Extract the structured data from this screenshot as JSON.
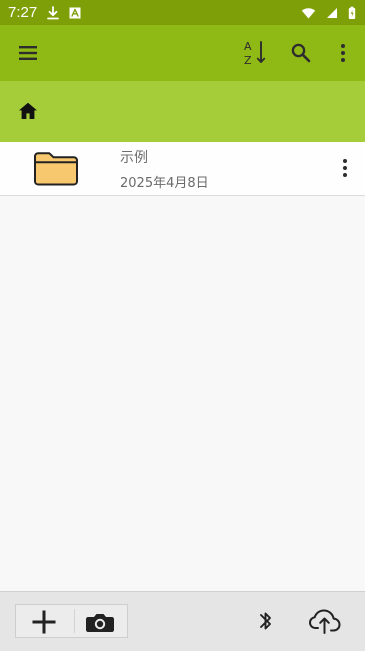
{
  "status_bar": {
    "time": "7:27",
    "left_icons": [
      "download-icon",
      "app-notification-icon"
    ],
    "right_icons": [
      "wifi-icon",
      "signal-icon",
      "battery-icon"
    ]
  },
  "toolbar": {
    "menu_icon": "hamburger-menu-icon",
    "sort_icon": "sort-az-icon",
    "search_icon": "search-icon",
    "more_icon": "more-vert-icon",
    "background": "#8fb915"
  },
  "path_bar": {
    "home_icon": "home-icon",
    "background": "#a5cd39"
  },
  "files": [
    {
      "name": "示例",
      "date": "2025年4月8日",
      "icon": "folder-icon",
      "menu_icon": "more-vert-icon"
    }
  ],
  "bottom_bar": {
    "left_icons": [
      "add-icon",
      "camera-icon"
    ],
    "right_icons": [
      "bluetooth-icon",
      "cloud-upload-icon"
    ],
    "background": "#e5e5e5"
  },
  "theme": {
    "status_bar_color": "#7f9f08",
    "folder_fill": "#f8c86f",
    "content_background": "#f8f8f8"
  }
}
